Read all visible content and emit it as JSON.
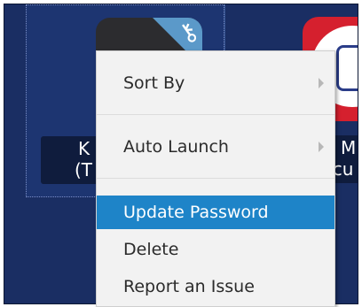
{
  "tiles": [
    {
      "icon_text": "k",
      "label_line1": "K",
      "label_line2": "(T"
    },
    {
      "label_line1": "S M",
      "label_line2": "ricu"
    }
  ],
  "context_menu": {
    "items": [
      {
        "label": "Sort By",
        "has_submenu": true
      },
      {
        "label": "Auto Launch",
        "has_submenu": true
      },
      {
        "label": "Update Password",
        "selected": true
      },
      {
        "label": "Delete"
      },
      {
        "label": "Report an Issue"
      }
    ]
  },
  "colors": {
    "background": "#1a2e63",
    "menu_background": "#f2f2f2",
    "selection": "#1e84c8"
  },
  "icons": {
    "key": "key-icon",
    "submenu_arrow": "chevron-right-icon"
  }
}
